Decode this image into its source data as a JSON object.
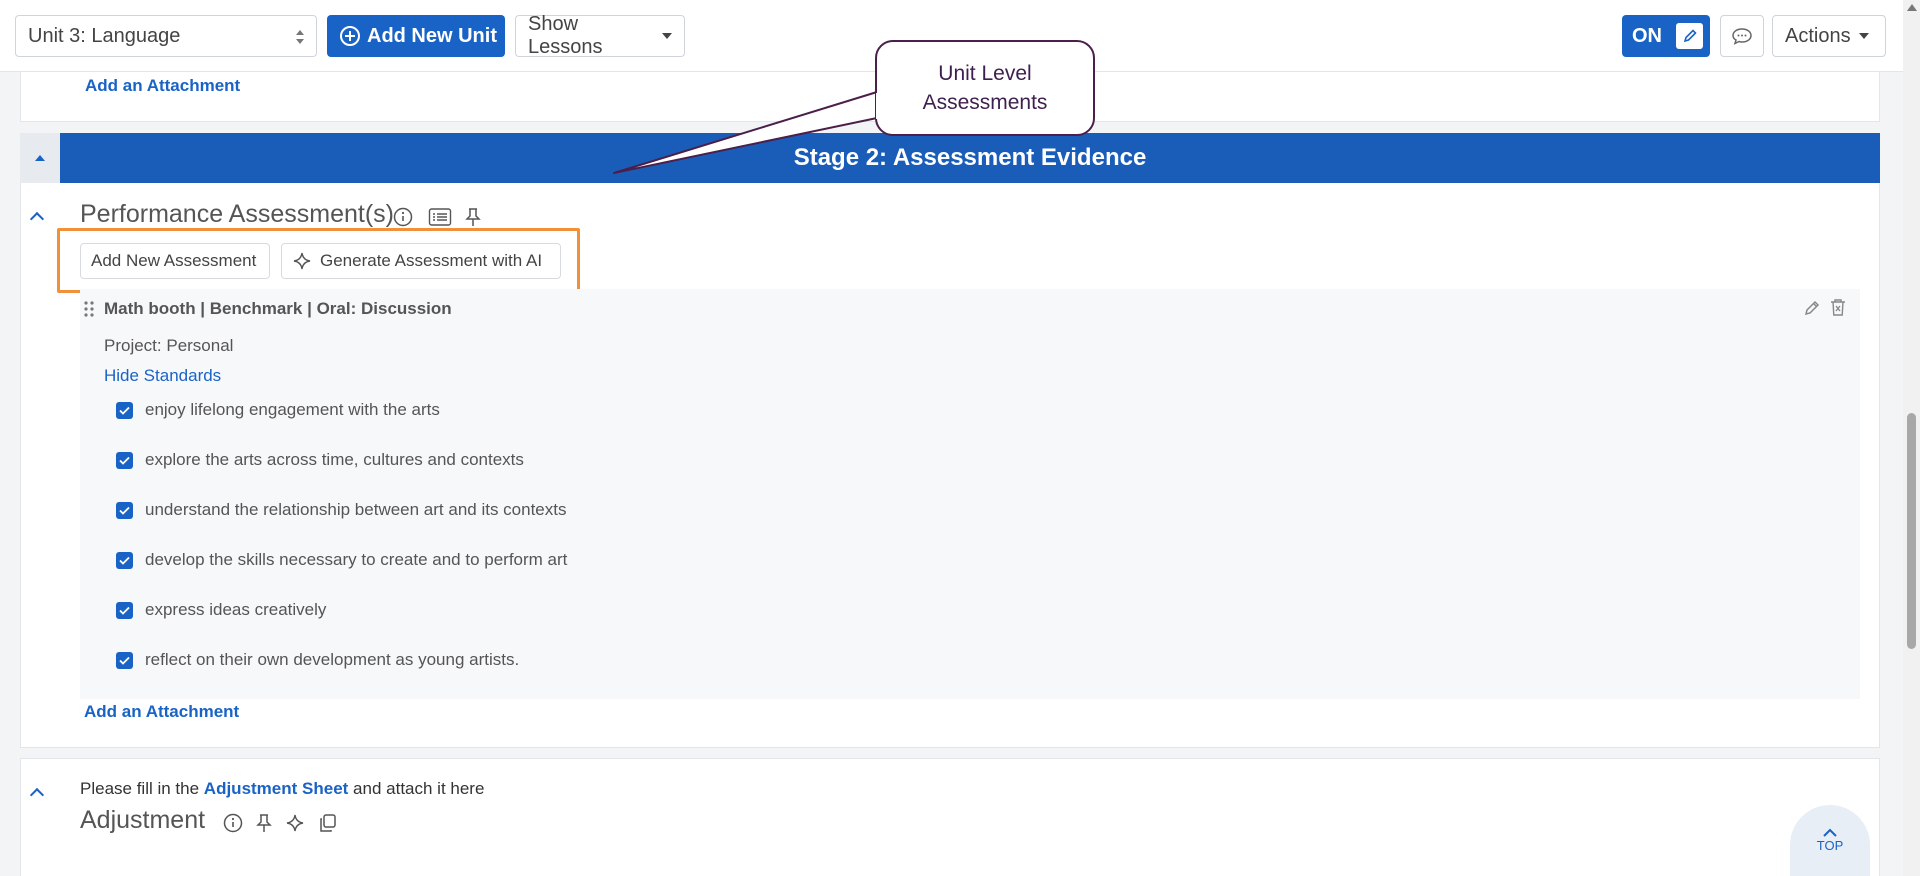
{
  "toolbar": {
    "unit_select": "Unit 3: Language",
    "add_unit_label": "Add New Unit",
    "show_lessons_label": "Show Lessons",
    "toggle_label": "ON",
    "actions_label": "Actions"
  },
  "upper_card": {
    "attachment_link": "Add an Attachment"
  },
  "stage": {
    "title": "Stage 2: Assessment Evidence"
  },
  "callout": {
    "line1": "Unit Level",
    "line2": "Assessments"
  },
  "performance": {
    "title": "Performance Assessment(s)",
    "add_button": "Add New Assessment",
    "ai_button": "Generate Assessment with AI",
    "item": {
      "title": "Math booth | Benchmark | Oral: Discussion",
      "project": "Project: Personal",
      "hide_standards": "Hide Standards",
      "standards": [
        "enjoy lifelong engagement with the arts",
        "explore the arts across time, cultures and contexts",
        "understand the relationship between art and its contexts",
        "develop the skills necessary to create and to perform art",
        "express ideas creatively",
        "reflect on their own development as young artists."
      ]
    },
    "attachment_link": "Add an Attachment"
  },
  "adjustment": {
    "note_prefix": "Please fill in the ",
    "note_link": "Adjustment Sheet",
    "note_suffix": " and attach it here",
    "title": "Adjustment"
  },
  "top_button": {
    "label": "TOP"
  },
  "colors": {
    "primary": "#1a63c6",
    "banner": "#1a5db9",
    "highlight": "#f0913a",
    "callout_border": "#4a1f4a"
  }
}
